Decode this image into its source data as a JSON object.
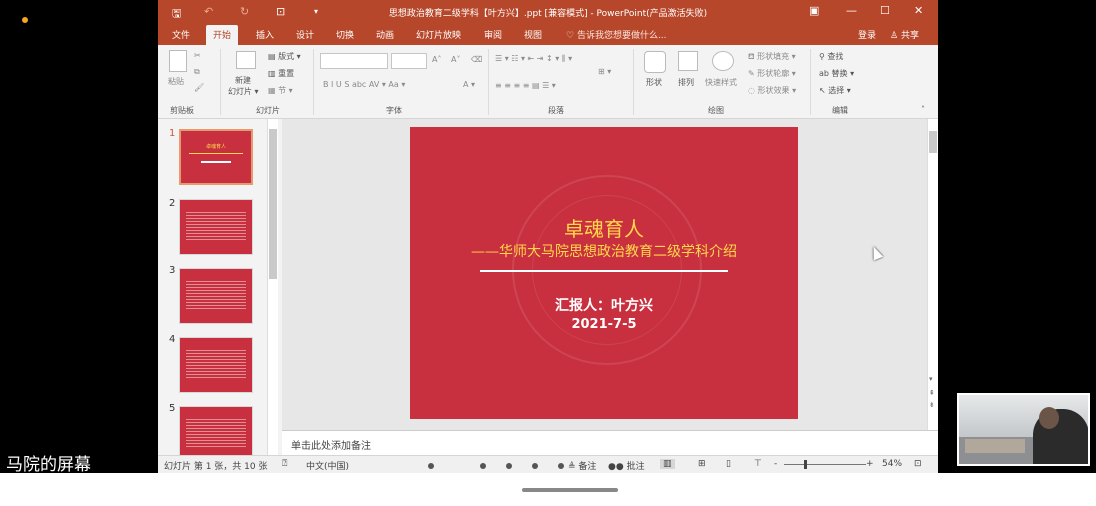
{
  "window": {
    "title": "思想政治教育二级学科【叶方兴】.ppt [兼容模式] - PowerPoint(产品激活失败)",
    "controls": [
      "—",
      "☐",
      "✕"
    ]
  },
  "tabs": [
    {
      "label": "文件"
    },
    {
      "label": "开始"
    },
    {
      "label": "插入"
    },
    {
      "label": "设计"
    },
    {
      "label": "切换"
    },
    {
      "label": "动画"
    },
    {
      "label": "幻灯片放映"
    },
    {
      "label": "审阅"
    },
    {
      "label": "视图"
    }
  ],
  "tell_me": "告诉我您想要做什么...",
  "account": {
    "login": "登录",
    "share": "共享"
  },
  "ribbon": {
    "clipboard": {
      "paste": "粘贴",
      "label": "剪贴板"
    },
    "slides": {
      "new_slide": "新建",
      "new_slide2": "幻灯片 ▾",
      "layout": "版式 ▾",
      "reset": "重置",
      "section": "节 ▾",
      "label": "幻灯片"
    },
    "font": {
      "label": "字体",
      "grow": "A˄",
      "shrink": "A˅",
      "buttons": "B  I  U  S  abc  AV ▾  Aa ▾",
      "color": "A ▾"
    },
    "paragraph": {
      "label": "段落"
    },
    "drawing": {
      "shape": "形状",
      "arrange": "排列",
      "quick_style": "快速样式",
      "fill": "形状填充 ▾",
      "outline": "形状轮廓 ▾",
      "effect": "形状效果 ▾",
      "label": "绘图"
    },
    "editing": {
      "find": "查找",
      "replace": "替换 ▾",
      "select": "选择 ▾",
      "label": "编辑"
    }
  },
  "thumbnails": [
    {
      "num": "1",
      "title": "卓魂育人",
      "sel": true
    },
    {
      "num": "2"
    },
    {
      "num": "3"
    },
    {
      "num": "4"
    },
    {
      "num": "5"
    }
  ],
  "slide": {
    "title": "卓魂育人",
    "subtitle": "——华师大马院思想政治教育二级学科介绍",
    "reporter": "汇报人：叶方兴",
    "date": "2021-7-5"
  },
  "notes_placeholder": "单击此处添加备注",
  "status": {
    "slide_info": "幻灯片 第 1 张，共 10 张",
    "language": "中文(中国)",
    "notes": "备注",
    "comments": "批注",
    "zoom": "54%"
  },
  "overlay": {
    "screen_label": "马院的屏幕"
  }
}
